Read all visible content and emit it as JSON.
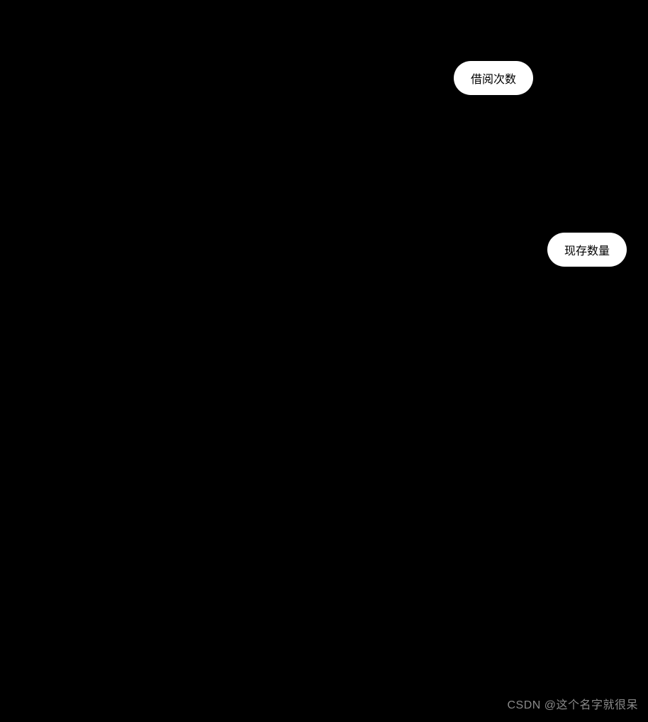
{
  "nodes": {
    "borrow_count": "借阅次数",
    "stock_count": "现存数量"
  },
  "watermark": "CSDN @这个名字就很呆"
}
